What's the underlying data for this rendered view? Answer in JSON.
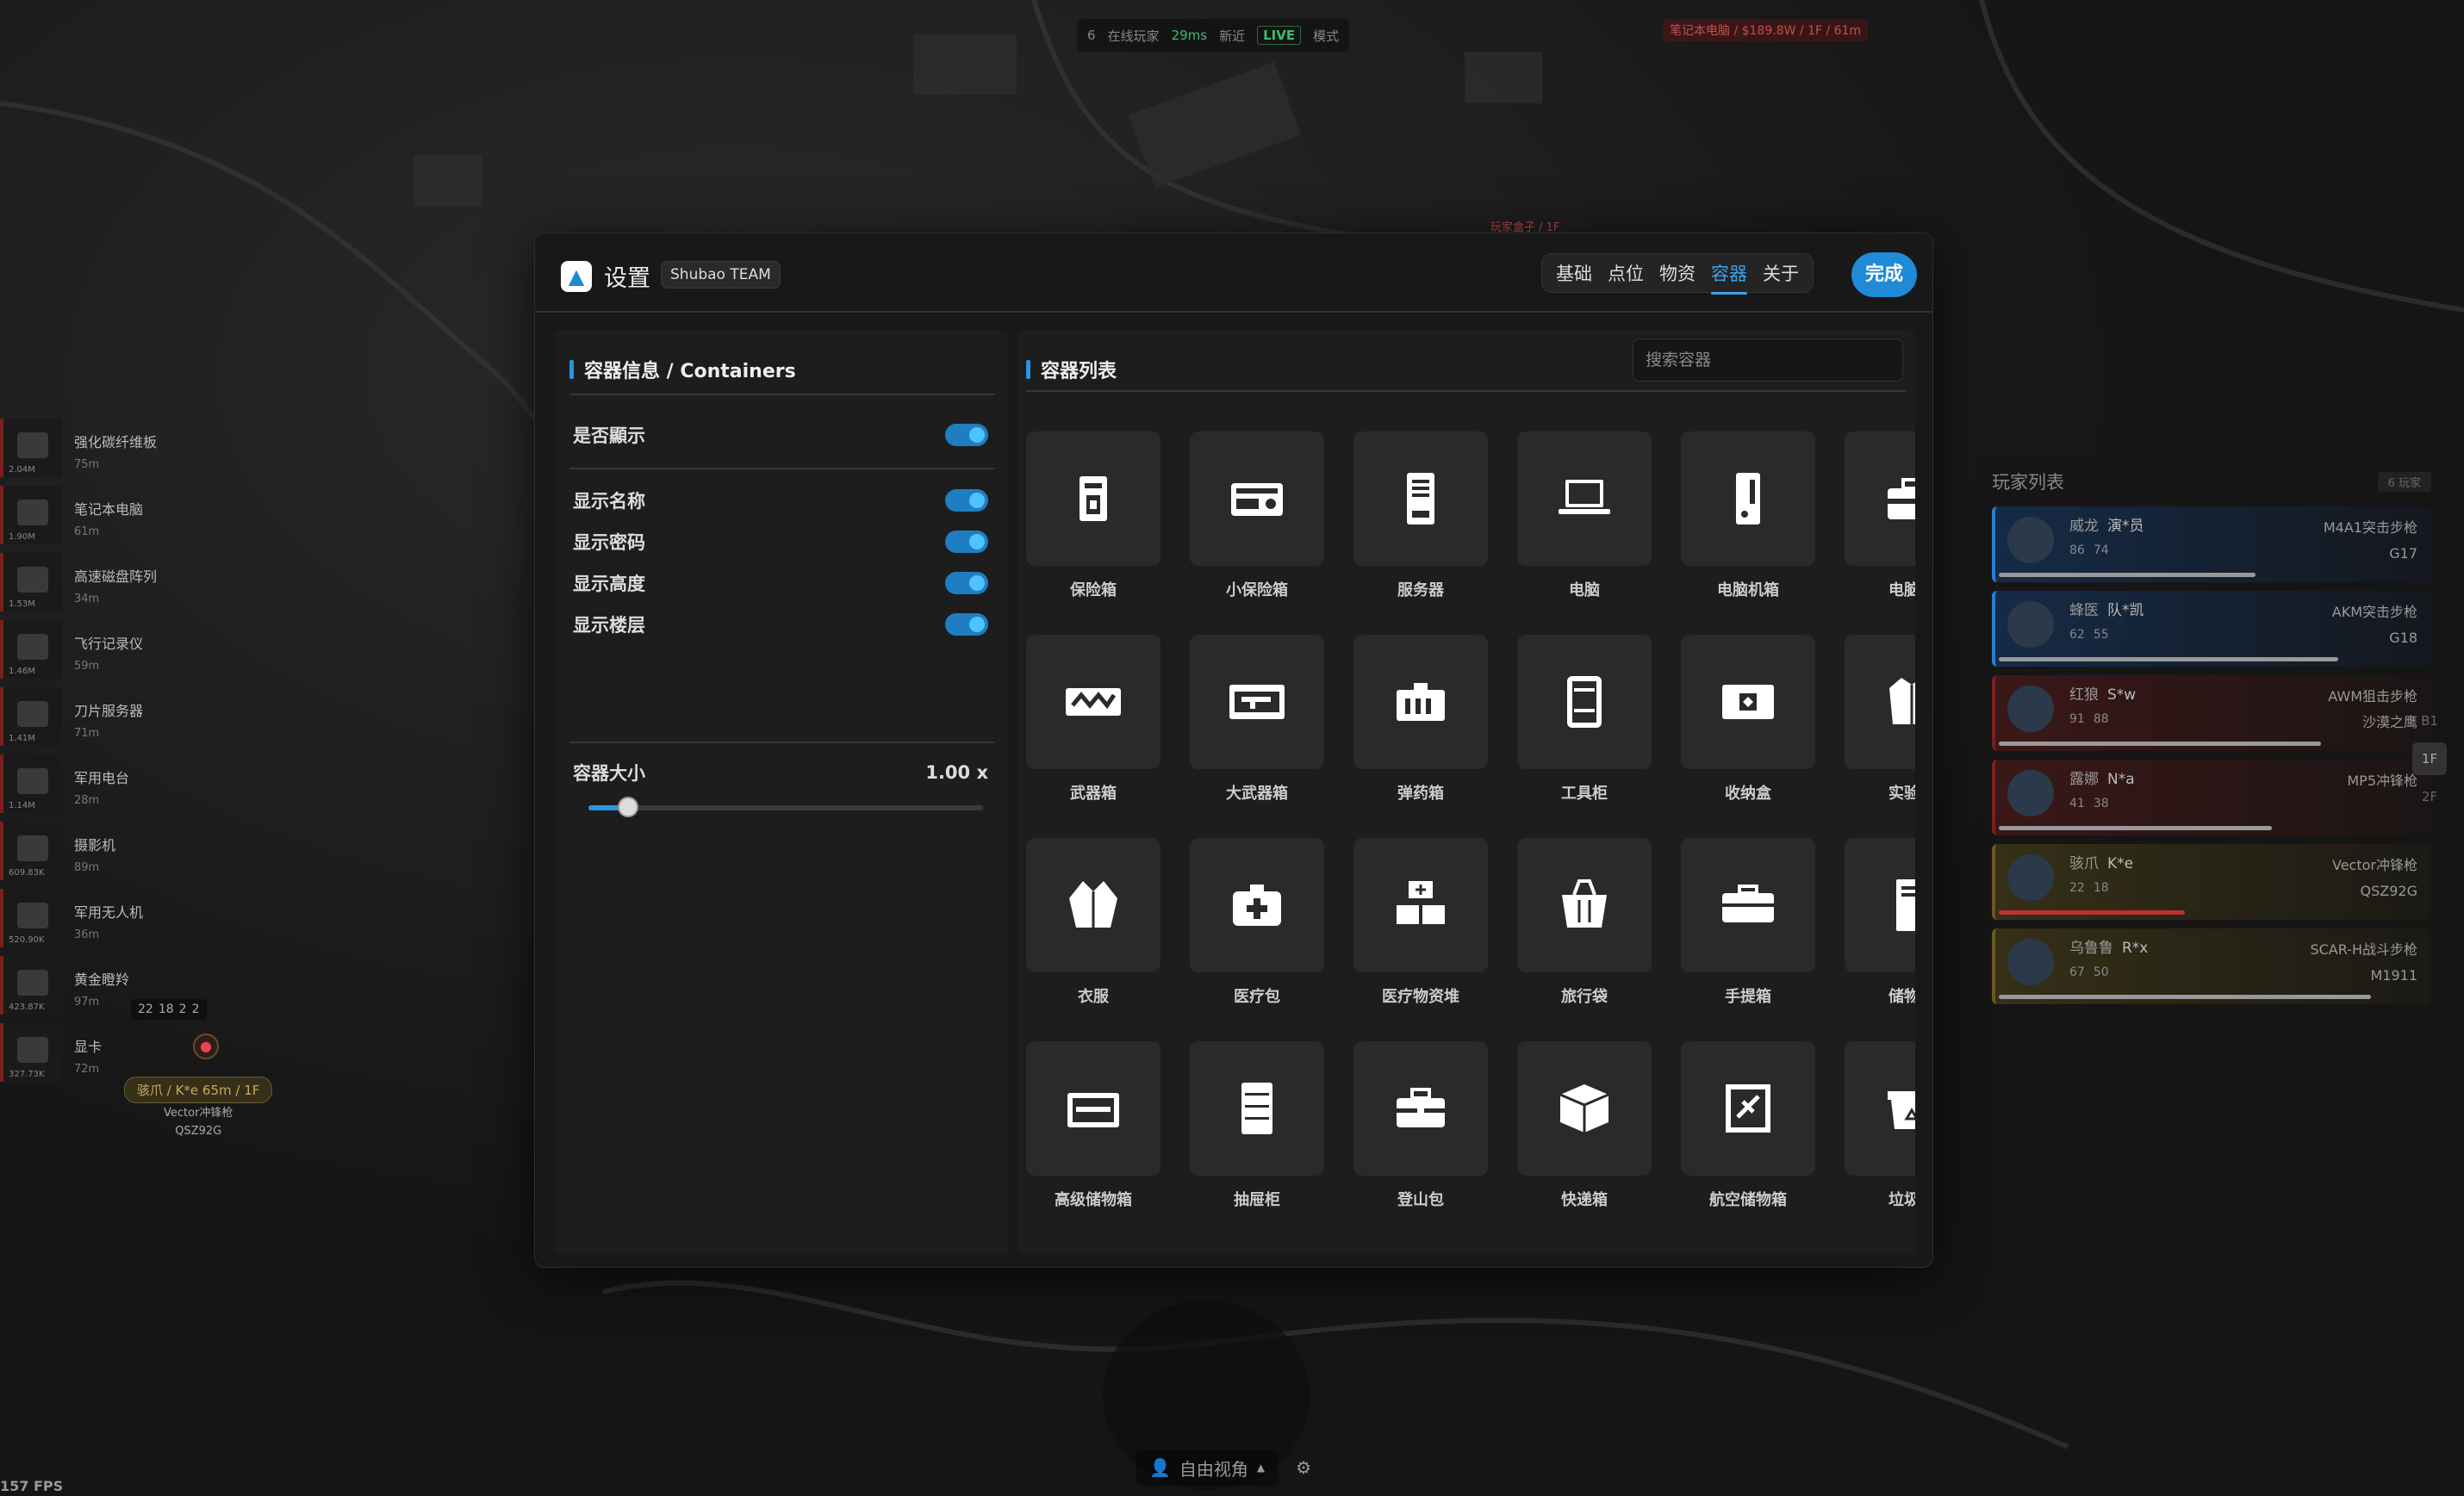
{
  "top": {
    "player_count": "6",
    "online_label": "在线玩家",
    "ping": "29ms",
    "recent": "新近",
    "live": "LIVE",
    "mode": "模式"
  },
  "map_tags": [
    "笔记本电脑 / $189.8W / 1F / 61m",
    "玩家盒子 / 1F"
  ],
  "loot": [
    {
      "name": "强化碳纤维板",
      "dist": "75m",
      "value": "2.04M"
    },
    {
      "name": "笔记本电脑",
      "dist": "61m",
      "value": "1.90M"
    },
    {
      "name": "高速磁盘阵列",
      "dist": "34m",
      "value": "1.53M"
    },
    {
      "name": "飞行记录仪",
      "dist": "59m",
      "value": "1.46M"
    },
    {
      "name": "刀片服务器",
      "dist": "71m",
      "value": "1.41M"
    },
    {
      "name": "军用电台",
      "dist": "28m",
      "value": "1.14M"
    },
    {
      "name": "摄影机",
      "dist": "89m",
      "value": "609.83K"
    },
    {
      "name": "军用无人机",
      "dist": "36m",
      "value": "520.90K"
    },
    {
      "name": "黄金瞪羚",
      "dist": "97m",
      "value": "423.87K"
    },
    {
      "name": "显卡",
      "dist": "72m",
      "value": "327.73K"
    }
  ],
  "map_stats": [
    "22",
    "18",
    "2",
    "2"
  ],
  "map_player": {
    "tag": "骇爪 / K*e 65m / 1F",
    "weapon": "Vector冲锋枪",
    "gun": "QSZ92G"
  },
  "fps": "157 FPS",
  "bottom": {
    "camera": "自由视角"
  },
  "players": {
    "title": "玩家列表",
    "count": "6 玩家",
    "list": [
      {
        "role": "威龙",
        "name": "演*员",
        "a": "86",
        "b": "74",
        "weapon": "M4A1突击步枪",
        "gun": "G17",
        "team": "blue",
        "hp": 0.62
      },
      {
        "role": "蜂医",
        "name": "队*凯",
        "a": "62",
        "b": "55",
        "weapon": "AKM突击步枪",
        "gun": "G18",
        "team": "blue",
        "hp": 0.82
      },
      {
        "role": "红狼",
        "name": "S*w",
        "a": "91",
        "b": "88",
        "weapon": "AWM狙击步枪",
        "gun": "沙漠之鹰",
        "team": "red",
        "hp": 0.78
      },
      {
        "role": "露娜",
        "name": "N*a",
        "a": "41",
        "b": "38",
        "weapon": "MP5冲锋枪",
        "gun": "",
        "team": "red",
        "hp": 0.66
      },
      {
        "role": "骇爪",
        "name": "K*e",
        "a": "22",
        "b": "18",
        "weapon": "Vector冲锋枪",
        "gun": "QSZ92G",
        "team": "gold",
        "hp": 0.45
      },
      {
        "role": "乌鲁鲁",
        "name": "R*x",
        "a": "67",
        "b": "50",
        "weapon": "SCAR-H战斗步枪",
        "gun": "M1911",
        "team": "gold",
        "hp": 0.9
      }
    ]
  },
  "floors": [
    "B1",
    "1F",
    "2F"
  ],
  "settings": {
    "title": "设置",
    "team": "Shubao TEAM",
    "tabs": [
      "基础",
      "点位",
      "物资",
      "容器",
      "关于"
    ],
    "active_tab": "容器",
    "done": "完成",
    "left_title": "容器信息 / Containers",
    "show_label": "是否顯示",
    "options": [
      "显示名称",
      "显示密码",
      "显示高度",
      "显示楼层"
    ],
    "size_label": "容器大小",
    "size_value": "1.00 x",
    "size_level": 0.1,
    "right_title": "容器列表",
    "search_placeholder": "搜索容器",
    "containers": [
      {
        "label": "保险箱",
        "icon": "safe-icon"
      },
      {
        "label": "小保险箱",
        "icon": "small-safe-icon"
      },
      {
        "label": "服务器",
        "icon": "server-icon"
      },
      {
        "label": "电脑",
        "icon": "laptop-icon"
      },
      {
        "label": "电脑机箱",
        "icon": "pc-case-icon"
      },
      {
        "label": "电脑包",
        "icon": "computer-bag-icon"
      },
      {
        "label": "武器箱",
        "icon": "weapon-case-icon"
      },
      {
        "label": "大武器箱",
        "icon": "large-weapon-case-icon"
      },
      {
        "label": "弹药箱",
        "icon": "ammo-box-icon"
      },
      {
        "label": "工具柜",
        "icon": "tool-cabinet-icon"
      },
      {
        "label": "收纳盒",
        "icon": "storage-box-icon"
      },
      {
        "label": "实验服",
        "icon": "lab-coat-icon"
      },
      {
        "label": "衣服",
        "icon": "jacket-icon"
      },
      {
        "label": "医疗包",
        "icon": "medkit-icon"
      },
      {
        "label": "医疗物资堆",
        "icon": "medical-supplies-icon"
      },
      {
        "label": "旅行袋",
        "icon": "travel-bag-icon"
      },
      {
        "label": "手提箱",
        "icon": "suitcase-icon"
      },
      {
        "label": "储物柜",
        "icon": "locker-icon"
      },
      {
        "label": "高级储物箱",
        "icon": "premium-storage-icon"
      },
      {
        "label": "抽屉柜",
        "icon": "drawer-cabinet-icon"
      },
      {
        "label": "登山包",
        "icon": "backpack-icon"
      },
      {
        "label": "快递箱",
        "icon": "parcel-icon"
      },
      {
        "label": "航空储物箱",
        "icon": "air-cargo-icon"
      },
      {
        "label": "垃圾箱",
        "icon": "trash-bin-icon"
      },
      {
        "label": "",
        "icon": "crates-icon"
      },
      {
        "label": "",
        "icon": "bowl-icon"
      },
      {
        "label": "",
        "icon": "round-target-icon"
      },
      {
        "label": "",
        "icon": "luggage-icon"
      },
      {
        "label": "",
        "icon": "shell-icon"
      },
      {
        "label": "",
        "icon": "bell-icon"
      }
    ]
  }
}
